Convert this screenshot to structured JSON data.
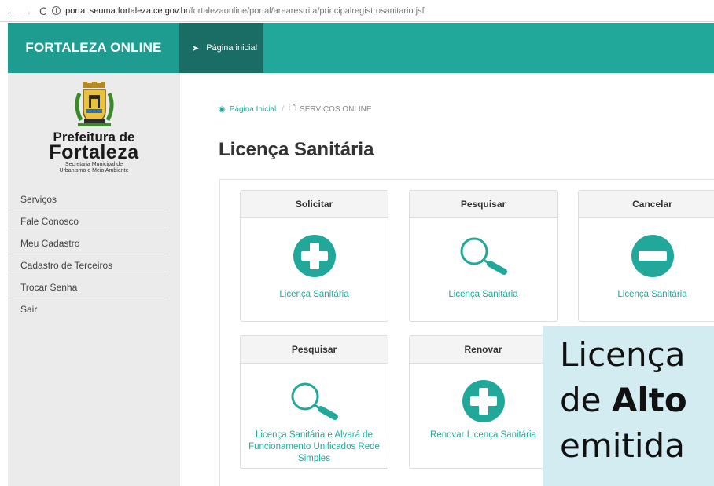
{
  "browser": {
    "back": "←",
    "forward": "→",
    "reload": "C",
    "url_host": "portal.seuma.fortaleza.ce.gov.br",
    "url_path": "/fortalezaonline/portal/arearestrita/principalregistrosanitario.jsf"
  },
  "header": {
    "brand": "FORTALEZA ONLINE",
    "home_tab": "Página inicial"
  },
  "logo": {
    "line1": "Prefeitura de",
    "line2": "Fortaleza",
    "line3": "Secretaria Municipal de",
    "line4": "Urbanismo e Meio Ambiente"
  },
  "sidebar": {
    "items": [
      {
        "label": "Serviços"
      },
      {
        "label": "Fale Conosco"
      },
      {
        "label": "Meu Cadastro"
      },
      {
        "label": "Cadastro de Terceiros"
      },
      {
        "label": "Trocar Senha"
      },
      {
        "label": "Sair"
      }
    ]
  },
  "breadcrumb": {
    "home": "Página Inicial",
    "current": "SERVIÇOS ONLINE"
  },
  "page": {
    "title": "Licença Sanitária"
  },
  "cards": [
    {
      "header": "Solicitar",
      "icon": "plus-circle-icon",
      "label": "Licença Sanitária"
    },
    {
      "header": "Pesquisar",
      "icon": "magnifier-icon",
      "label": "Licença Sanitária"
    },
    {
      "header": "Cancelar",
      "icon": "minus-circle-icon",
      "label": "Licença Sanitária"
    },
    {
      "header": "Pesquisar",
      "icon": "magnifier-icon",
      "label": "Licença Sanitária e Alvará de Funcionamento Unificados Rede Simples"
    },
    {
      "header": "Renovar",
      "icon": "plus-circle-icon",
      "label": "Renovar Licença Sanitária"
    }
  ],
  "overlay": {
    "line1": "Licença",
    "line2_pre": "de ",
    "line2_bold": "Alto",
    "line3": "emitida"
  },
  "colors": {
    "teal": "#22a89b",
    "teal_dark": "#1a6d65",
    "sidebar_bg": "#ebebeb"
  }
}
